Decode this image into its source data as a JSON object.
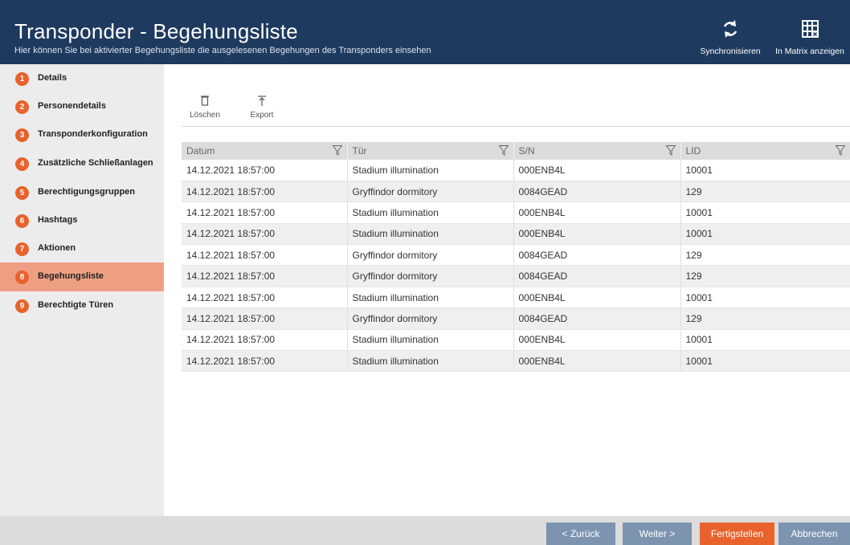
{
  "header": {
    "title": "Transponder - Begehungsliste",
    "subtitle": "Hier können Sie bei aktivierter Begehungsliste die ausgelesenen Begehungen des Transponders einsehen",
    "sync_label": "Synchronisieren",
    "sync_icon": "sync-icon",
    "matrix_label": "In Matrix anzeigen",
    "matrix_icon": "matrix-grid-icon"
  },
  "sidebar": {
    "items": [
      {
        "num": "1",
        "label": "Details"
      },
      {
        "num": "2",
        "label": "Personendetails"
      },
      {
        "num": "3",
        "label": "Transponderkonfiguration"
      },
      {
        "num": "4",
        "label": "Zusätzliche Schließanlagen"
      },
      {
        "num": "5",
        "label": "Berechtigungsgruppen"
      },
      {
        "num": "6",
        "label": "Hashtags"
      },
      {
        "num": "7",
        "label": "Aktionen"
      },
      {
        "num": "8",
        "label": "Begehungsliste"
      },
      {
        "num": "9",
        "label": "Berechtigte Türen"
      }
    ],
    "active_index": 7
  },
  "toolbar": {
    "delete_label": "Löschen",
    "export_label": "Export"
  },
  "table": {
    "columns": [
      "Datum",
      "Tür",
      "S/N",
      "LID"
    ],
    "rows": [
      [
        "14.12.2021 18:57:00",
        "Stadium illumination",
        "000ENB4L",
        "10001"
      ],
      [
        "14.12.2021 18:57:00",
        "Gryffindor dormitory",
        "0084GEAD",
        "129"
      ],
      [
        "14.12.2021 18:57:00",
        "Stadium illumination",
        "000ENB4L",
        "10001"
      ],
      [
        "14.12.2021 18:57:00",
        "Stadium illumination",
        "000ENB4L",
        "10001"
      ],
      [
        "14.12.2021 18:57:00",
        "Gryffindor dormitory",
        "0084GEAD",
        "129"
      ],
      [
        "14.12.2021 18:57:00",
        "Gryffindor dormitory",
        "0084GEAD",
        "129"
      ],
      [
        "14.12.2021 18:57:00",
        "Stadium illumination",
        "000ENB4L",
        "10001"
      ],
      [
        "14.12.2021 18:57:00",
        "Gryffindor dormitory",
        "0084GEAD",
        "129"
      ],
      [
        "14.12.2021 18:57:00",
        "Stadium illumination",
        "000ENB4L",
        "10001"
      ],
      [
        "14.12.2021 18:57:00",
        "Stadium illumination",
        "000ENB4L",
        "10001"
      ]
    ]
  },
  "footer": {
    "back_label": "< Zurück",
    "next_label": "Weiter >",
    "finish_label": "Fertigstellen",
    "cancel_label": "Abbrechen"
  },
  "colors": {
    "header_bg": "#1e3a5f",
    "accent": "#e8622c",
    "active_nav": "#ee9f83",
    "footer_button": "#7d94b0"
  }
}
